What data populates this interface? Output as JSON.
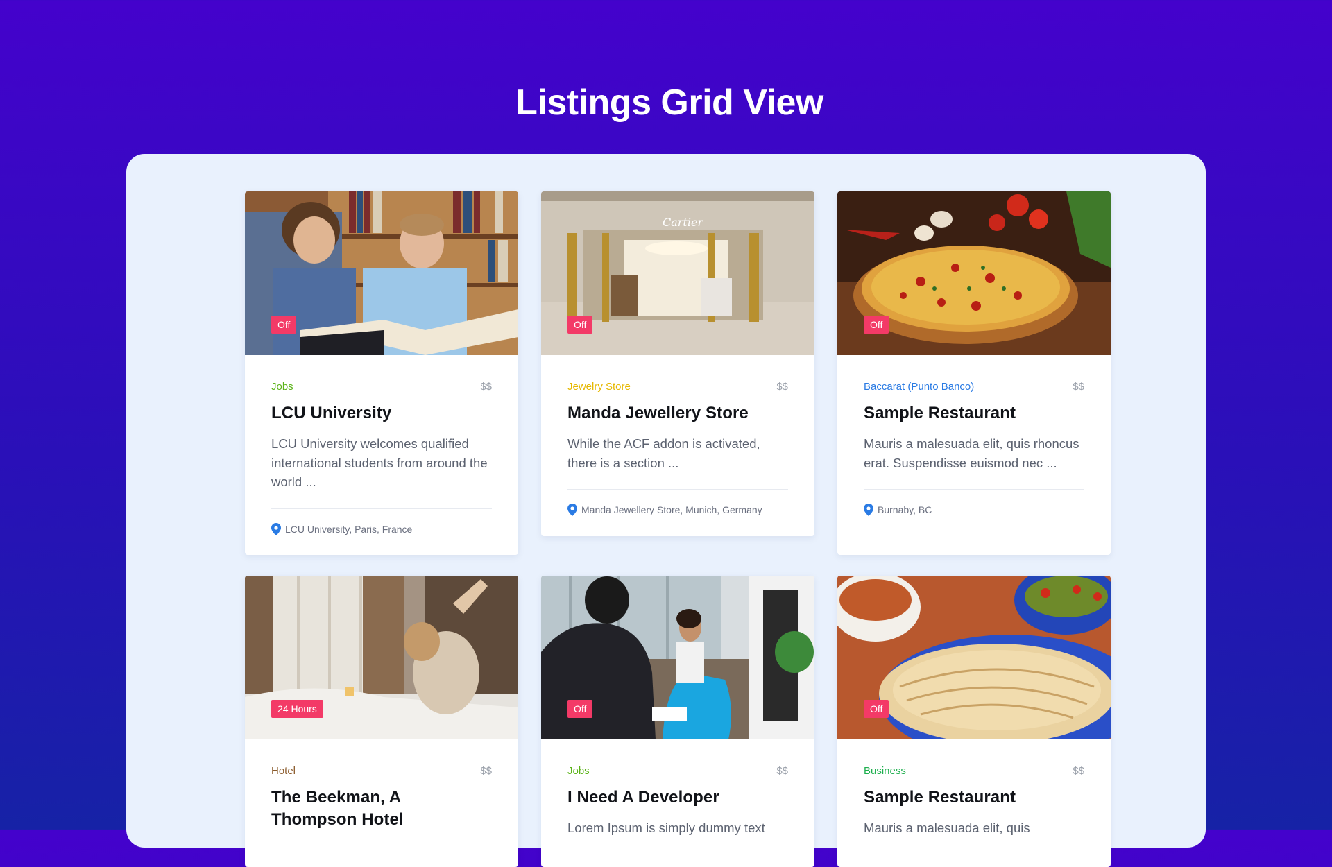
{
  "page": {
    "title": "Listings Grid View"
  },
  "listings": [
    {
      "badge": "Off",
      "category": "Jobs",
      "category_color": "#5bb318",
      "price": "$$",
      "title": "LCU University",
      "description": "LCU University welcomes qualified international students from around the world ...",
      "location": "LCU University, Paris, France"
    },
    {
      "badge": "Off",
      "category": "Jewelry Store",
      "category_color": "#e6b800",
      "price": "$$",
      "title": "Manda Jewellery Store",
      "description": "While the ACF addon is activated, there is a section ...",
      "location": "Manda Jewellery Store, Munich, Germany"
    },
    {
      "badge": "Off",
      "category": "Baccarat (Punto Banco)",
      "category_color": "#2a7be4",
      "price": "$$",
      "title": "Sample Restaurant",
      "description": "Mauris a malesuada elit, quis rhoncus erat. Suspendisse euismod nec ...",
      "location": "Burnaby, BC"
    },
    {
      "badge": "24 Hours",
      "category": "Hotel",
      "category_color": "#8a5a2b",
      "price": "$$",
      "title": "The Beekman, A Thompson Hotel",
      "description": "",
      "location": ""
    },
    {
      "badge": "Off",
      "category": "Jobs",
      "category_color": "#5bb318",
      "price": "$$",
      "title": "I Need A Developer",
      "description": "Lorem Ipsum is simply dummy text",
      "location": ""
    },
    {
      "badge": "Off",
      "category": "Business",
      "category_color": "#1fb04f",
      "price": "$$",
      "title": "Sample Restaurant",
      "description": "Mauris a malesuada elit, quis",
      "location": ""
    }
  ],
  "colors": {
    "badge": "#f33a67",
    "pin": "#2a7be4",
    "accent_bg_top": "#4402cc",
    "accent_bg_bottom": "#1622a6",
    "panel": "#e9f1fd"
  }
}
